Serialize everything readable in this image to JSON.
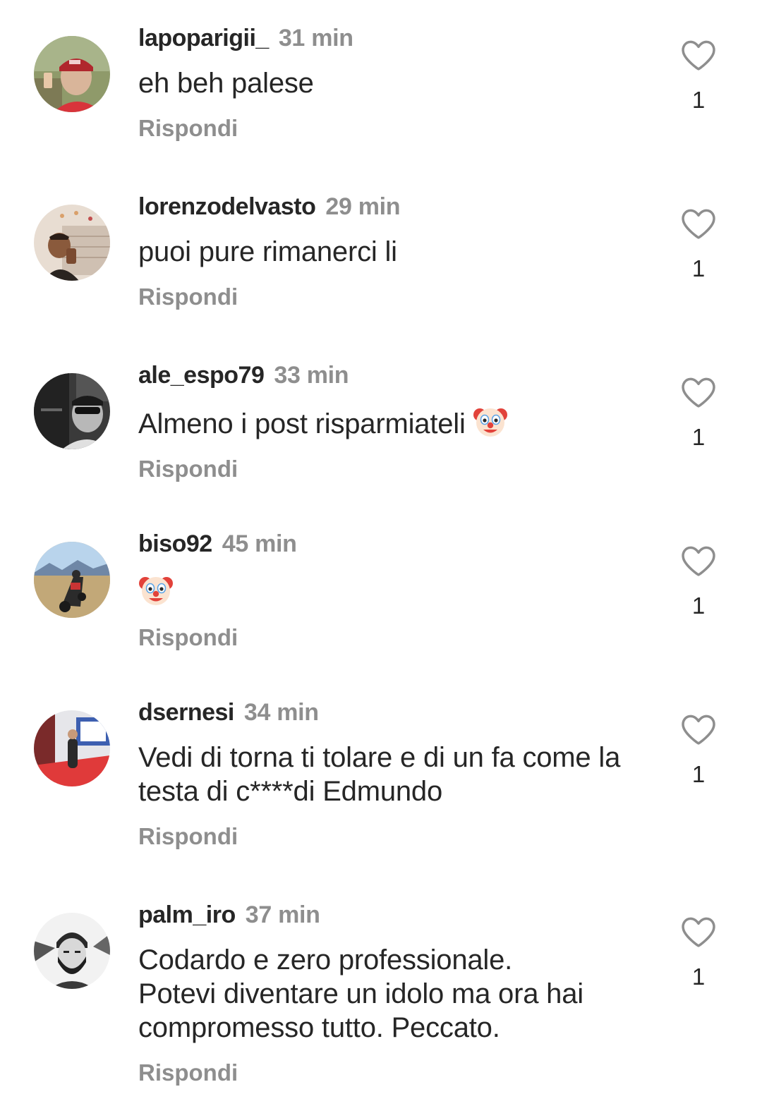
{
  "comments": [
    {
      "username": "lapoparigii_",
      "time": "31 min",
      "text": "eh beh palese",
      "emoji": "",
      "reply_label": "Rispondi",
      "likes": "1",
      "avatar_icon": "profile-photo-man-red-cap"
    },
    {
      "username": "lorenzodelvasto",
      "time": "29 min",
      "text": "puoi pure rimanerci li",
      "emoji": "",
      "reply_label": "Rispondi",
      "likes": "1",
      "avatar_icon": "profile-photo-man-selfie"
    },
    {
      "username": "ale_espo79",
      "time": "33 min",
      "text": "Almeno i post risparmiateli",
      "emoji": "clown-face-emoji",
      "reply_label": "Rispondi",
      "likes": "1",
      "avatar_icon": "profile-photo-man-sunglasses-bw"
    },
    {
      "username": "biso92",
      "time": "45 min",
      "text": "",
      "emoji": "clown-face-emoji",
      "reply_label": "Rispondi",
      "likes": "1",
      "avatar_icon": "profile-photo-motorcycle"
    },
    {
      "username": "dsernesi",
      "time": "34 min",
      "text": "Vedi di torna ti tolare e di un fa come la\ntesta di c****di Edmundo",
      "emoji": "",
      "reply_label": "Rispondi",
      "likes": "1",
      "avatar_icon": "profile-photo-red-carpet"
    },
    {
      "username": "palm_iro",
      "time": "37 min",
      "text": "Codardo e zero professionale.\nPotevi diventare un idolo ma ora hai\ncompromesso tutto. Peccato.",
      "emoji": "",
      "reply_label": "Rispondi",
      "likes": "1",
      "avatar_icon": "profile-photo-bearded-man-bw"
    }
  ],
  "colors": {
    "text": "#262626",
    "secondary": "#8e8e8e",
    "background": "#ffffff"
  }
}
